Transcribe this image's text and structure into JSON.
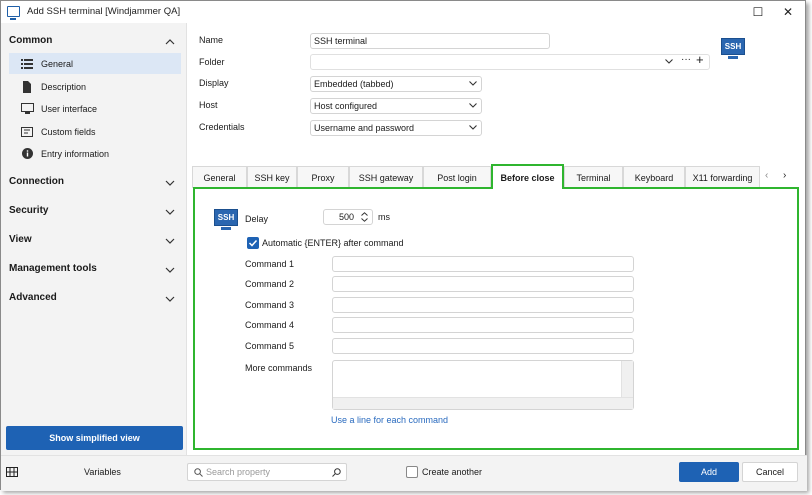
{
  "window": {
    "title": "Add SSH terminal [Windjammer QA]",
    "minimize_glyph": "—",
    "maximize_glyph": "☐",
    "close_glyph": "✕"
  },
  "sidebar": {
    "sections": [
      {
        "label": "Common",
        "expanded": true
      },
      {
        "label": "Connection",
        "expanded": false
      },
      {
        "label": "Security",
        "expanded": false
      },
      {
        "label": "View",
        "expanded": false
      },
      {
        "label": "Management tools",
        "expanded": false
      },
      {
        "label": "Advanced",
        "expanded": false
      }
    ],
    "items": [
      {
        "label": "General",
        "icon": "list-icon",
        "selected": true
      },
      {
        "label": "Description",
        "icon": "document-icon",
        "selected": false
      },
      {
        "label": "User interface",
        "icon": "monitor-icon",
        "selected": false
      },
      {
        "label": "Custom fields",
        "icon": "custom-fields-icon",
        "selected": false
      },
      {
        "label": "Entry information",
        "icon": "info-icon",
        "selected": false
      }
    ],
    "simplified_view_label": "Show simplified view"
  },
  "form": {
    "name": {
      "label": "Name",
      "value": "SSH terminal"
    },
    "folder": {
      "label": "Folder",
      "value": ""
    },
    "display": {
      "label": "Display",
      "value": "Embedded (tabbed)"
    },
    "host": {
      "label": "Host",
      "value": "Host configured"
    },
    "credentials": {
      "label": "Credentials",
      "value": "Username and password"
    },
    "logo_text": "SSH"
  },
  "tabs": [
    {
      "label": "General",
      "active": false
    },
    {
      "label": "SSH key",
      "active": false
    },
    {
      "label": "Proxy",
      "active": false
    },
    {
      "label": "SSH gateway",
      "active": false
    },
    {
      "label": "Post login",
      "active": false
    },
    {
      "label": "Before close",
      "active": true
    },
    {
      "label": "Terminal",
      "active": false
    },
    {
      "label": "Keyboard",
      "active": false
    },
    {
      "label": "X11 forwarding",
      "active": false
    }
  ],
  "before_close": {
    "logo_text": "SSH",
    "delay_label": "Delay",
    "delay_value": "500",
    "delay_unit": "ms",
    "auto_enter_label": "Automatic {ENTER} after command",
    "auto_enter_checked": true,
    "commands": [
      {
        "label": "Command 1",
        "value": ""
      },
      {
        "label": "Command 2",
        "value": ""
      },
      {
        "label": "Command 3",
        "value": ""
      },
      {
        "label": "Command 4",
        "value": ""
      },
      {
        "label": "Command 5",
        "value": ""
      }
    ],
    "more_commands_label": "More commands",
    "more_commands_value": "",
    "hint_link": "Use a line for each command"
  },
  "bottom": {
    "variables_label": "Variables",
    "search_placeholder": "Search property",
    "create_another_label": "Create another",
    "create_another_checked": false,
    "add_label": "Add",
    "cancel_label": "Cancel"
  },
  "colors": {
    "accent": "#1e62b4",
    "highlight_border": "#2fb52f",
    "selected_item": "#dce7f5",
    "link": "#2a6bbf"
  }
}
